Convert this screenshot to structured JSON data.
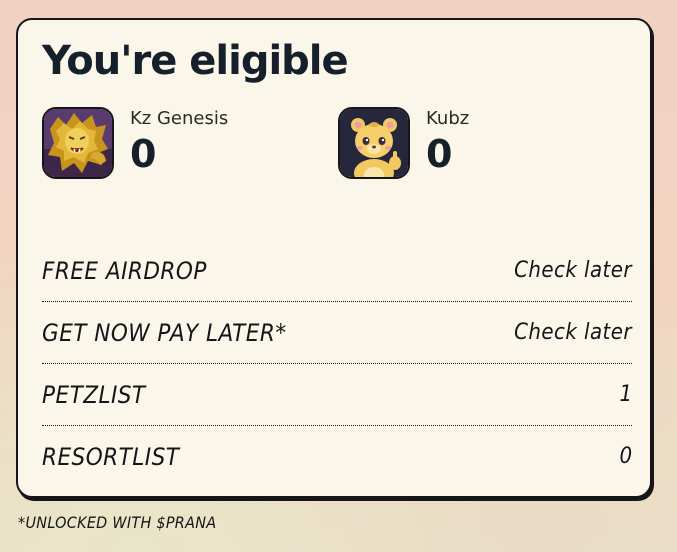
{
  "card": {
    "title": "You're eligible",
    "collections": [
      {
        "name": "Kz Genesis",
        "count": "0",
        "icon": "lion-avatar-icon"
      },
      {
        "name": "Kubz",
        "count": "0",
        "icon": "cub-avatar-icon"
      }
    ],
    "rows": [
      {
        "label": "FREE AIRDROP",
        "value": "Check later"
      },
      {
        "label": "GET NOW PAY LATER*",
        "value": "Check later"
      },
      {
        "label": "PETZLIST",
        "value": "1"
      },
      {
        "label": "RESORTLIST",
        "value": "0"
      }
    ]
  },
  "footnote": "*UNLOCKED WITH $PRANA",
  "colors": {
    "card_bg": "#fbf6ea",
    "border": "#16161a",
    "text_dark": "#16202a",
    "page_bg_peach": "#f0d2c2"
  }
}
